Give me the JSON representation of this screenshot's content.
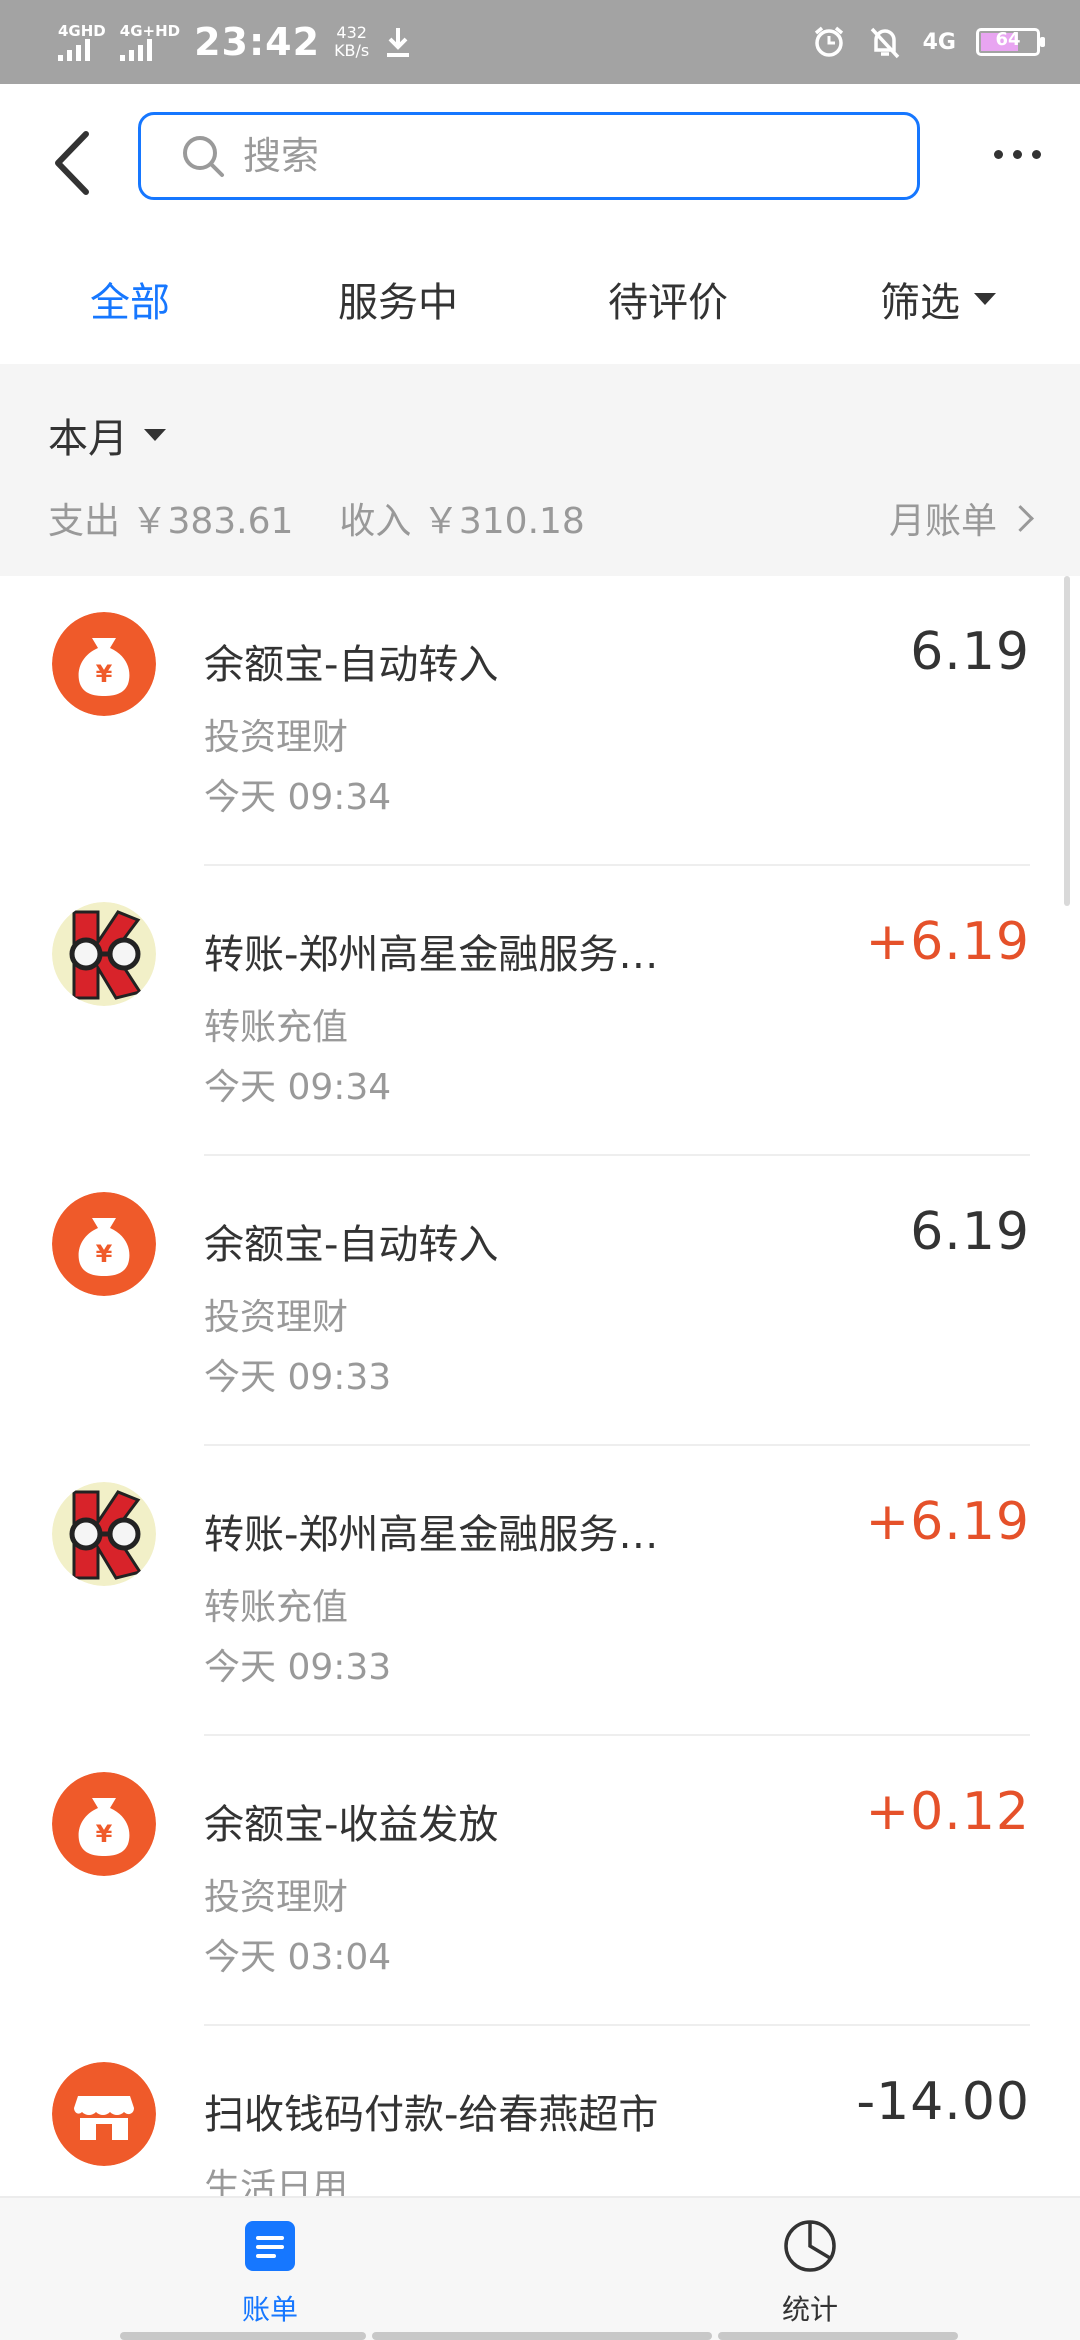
{
  "status_bar": {
    "sim1": "4GHD",
    "sim2": "4G+HD",
    "time": "23:42",
    "speed_value": "432",
    "speed_unit": "KB/s",
    "network": "4G",
    "battery": "64"
  },
  "header": {
    "search_placeholder": "搜索"
  },
  "tabs": [
    {
      "label": "全部"
    },
    {
      "label": "服务中"
    },
    {
      "label": "待评价"
    },
    {
      "label": "筛选"
    }
  ],
  "summary": {
    "month": "本月",
    "expense": "支出 ￥383.61",
    "income": "收入 ￥310.18",
    "monthly_bill": "月账单"
  },
  "transactions": [
    {
      "title": "余额宝-自动转入",
      "category": "投资理财",
      "time": "今天  09:34",
      "amount": "6.19",
      "icon": "yuebao-moneybag-icon"
    },
    {
      "title": "转账-郑州高星金融服务…",
      "category": "转账充值",
      "time": "今天  09:34",
      "amount": "+6.19",
      "icon": "user-avatar"
    },
    {
      "title": "余额宝-自动转入",
      "category": "投资理财",
      "time": "今天  09:33",
      "amount": "6.19",
      "icon": "yuebao-moneybag-icon"
    },
    {
      "title": "转账-郑州高星金融服务…",
      "category": "转账充值",
      "time": "今天  09:33",
      "amount": "+6.19",
      "icon": "user-avatar"
    },
    {
      "title": "余额宝-收益发放",
      "category": "投资理财",
      "time": "今天  03:04",
      "amount": "+0.12",
      "icon": "yuebao-moneybag-icon"
    },
    {
      "title": "扫收钱码付款-给春燕超市",
      "category": "生活日用",
      "time": "",
      "amount": "-14.00",
      "icon": "shop-icon"
    }
  ],
  "bottom_nav": {
    "bill": "账单",
    "stats": "统计"
  },
  "colors": {
    "accent": "#1677ff",
    "income": "#e5512a",
    "icon_orange": "#ef5a2a"
  }
}
